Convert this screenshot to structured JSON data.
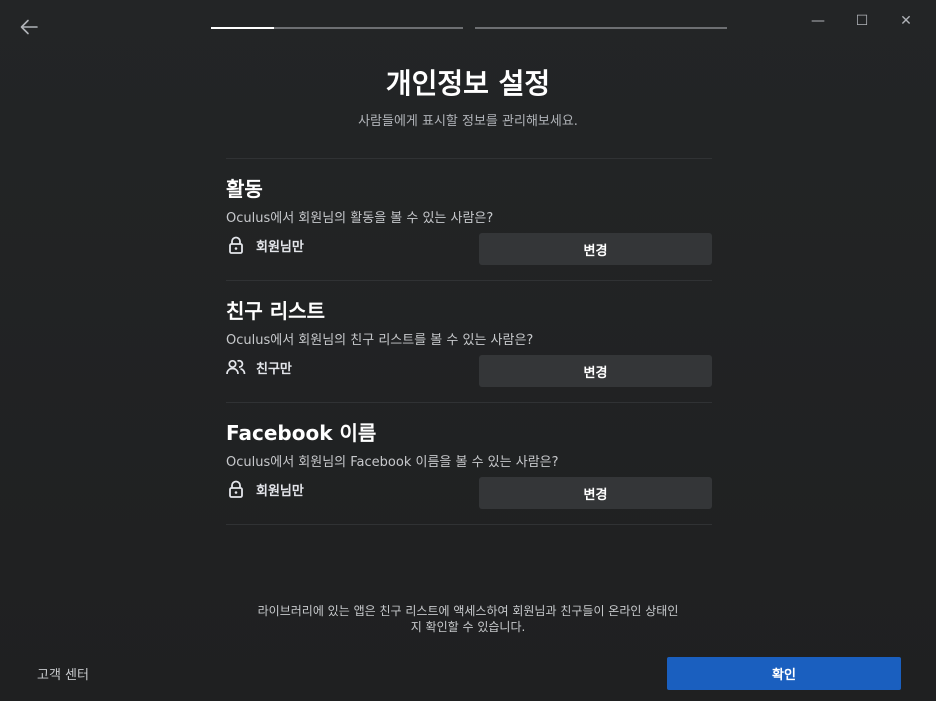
{
  "window": {
    "minimize_glyph": "—",
    "maximize_glyph": "☐",
    "close_glyph": "✕"
  },
  "progress": {
    "step_1_fill": 0.25,
    "step_2_fill": 0
  },
  "header": {
    "title": "개인정보 설정",
    "subtitle": "사람들에게 표시할 정보를 관리해보세요."
  },
  "sections": [
    {
      "title": "활동",
      "question": "Oculus에서 회원님의 활동을 볼 수 있는 사람은?",
      "value": "회원님만",
      "icon": "lock-icon",
      "button_label": "변경"
    },
    {
      "title": "친구 리스트",
      "question": "Oculus에서 회원님의 친구 리스트를 볼 수 있는 사람은?",
      "value": "친구만",
      "icon": "friends-icon",
      "button_label": "변경"
    },
    {
      "title": "Facebook 이름",
      "question": "Oculus에서 회원님의 Facebook 이름을 볼 수 있는 사람은?",
      "value": "회원님만",
      "icon": "lock-icon",
      "button_label": "변경"
    }
  ],
  "footer": {
    "note_line1": "라이브러리에 있는 앱은 친구 리스트에 액세스하여 회원님과 친구들이 온라인 상태인",
    "note_line2": "지 확인할 수 있습니다.",
    "help_label": "고객 센터",
    "confirm_label": "확인"
  },
  "colors": {
    "background": "#212324",
    "button": "#343638",
    "primary": "#1a5fbf"
  }
}
